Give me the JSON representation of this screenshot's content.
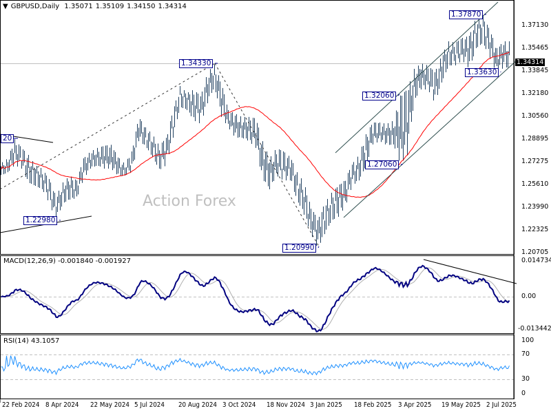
{
  "header": {
    "symbol": "GBPUSD,Daily",
    "open": "1.35071",
    "high": "1.35109",
    "low": "1.34150",
    "close": "1.34314"
  },
  "watermark": "Action Forex",
  "chart_data": [
    {
      "type": "ohlc",
      "title": "GBPUSD,Daily",
      "ylim": [
        1.206,
        1.3892
      ],
      "y_ticks": [
        "1.37130",
        "1.35465",
        "1.33845",
        "1.32180",
        "1.30560",
        "1.28895",
        "1.27275",
        "1.25610",
        "1.23990",
        "1.22325",
        "1.20705"
      ],
      "x_ticks": [
        "22 Feb 2024",
        "8 Apr 2024",
        "22 May 2024",
        "5 Jul 2024",
        "20 Aug 2024",
        "3 Oct 2024",
        "18 Nov 2024",
        "3 Jan 2025",
        "18 Feb 2025",
        "3 Apr 2025",
        "19 May 2025",
        "2 Jul 2025"
      ],
      "current_price": "1.34314",
      "grid": false,
      "moving_average_color": "#ff0000",
      "bar_color": "#1f3f5f",
      "weekly_high_low": [
        [
          1.2717,
          1.2627
        ],
        [
          1.2752,
          1.2652
        ],
        [
          1.2891,
          1.2702
        ],
        [
          1.2827,
          1.2677
        ],
        [
          1.2777,
          1.2578
        ],
        [
          1.2702,
          1.2553
        ],
        [
          1.2677,
          1.2528
        ],
        [
          1.2602,
          1.2428
        ],
        [
          1.2478,
          1.2298
        ],
        [
          1.2578,
          1.2428
        ],
        [
          1.2627,
          1.2453
        ],
        [
          1.2592,
          1.2463
        ],
        [
          1.2752,
          1.2602
        ],
        [
          1.2802,
          1.2677
        ],
        [
          1.2827,
          1.2702
        ],
        [
          1.2842,
          1.2677
        ],
        [
          1.2852,
          1.2677
        ],
        [
          1.2762,
          1.2627
        ],
        [
          1.2712,
          1.2627
        ],
        [
          1.2802,
          1.2652
        ],
        [
          1.3051,
          1.2876
        ],
        [
          1.2976,
          1.2842
        ],
        [
          1.2926,
          1.2762
        ],
        [
          1.2842,
          1.2667
        ],
        [
          1.2901,
          1.2702
        ],
        [
          1.3101,
          1.2901
        ],
        [
          1.3275,
          1.3125
        ],
        [
          1.3225,
          1.3101
        ],
        [
          1.325,
          1.3026
        ],
        [
          1.32,
          1.3001
        ],
        [
          1.3374,
          1.315
        ],
        [
          1.3433,
          1.3275
        ],
        [
          1.33,
          1.3051
        ],
        [
          1.3101,
          1.2976
        ],
        [
          1.3076,
          1.2901
        ],
        [
          1.3051,
          1.2901
        ],
        [
          1.3051,
          1.2876
        ],
        [
          1.3041,
          1.2827
        ],
        [
          1.2876,
          1.2602
        ],
        [
          1.2752,
          1.2528
        ],
        [
          1.2827,
          1.2627
        ],
        [
          1.2802,
          1.2592
        ],
        [
          1.2762,
          1.2592
        ],
        [
          1.2652,
          1.2453
        ],
        [
          1.2578,
          1.2344
        ],
        [
          1.2403,
          1.2204
        ],
        [
          1.2304,
          1.2099
        ],
        [
          1.2428,
          1.2204
        ],
        [
          1.2503,
          1.2304
        ],
        [
          1.2553,
          1.2329
        ],
        [
          1.2602,
          1.2403
        ],
        [
          1.2712,
          1.2553
        ],
        [
          1.2777,
          1.2592
        ],
        [
          1.2926,
          1.2702
        ],
        [
          1.3011,
          1.2852
        ],
        [
          1.3011,
          1.2876
        ],
        [
          1.3001,
          1.2847
        ],
        [
          1.3026,
          1.2852
        ],
        [
          1.3206,
          1.2706
        ],
        [
          1.325,
          1.2777
        ],
        [
          1.3399,
          1.3175
        ],
        [
          1.3439,
          1.325
        ],
        [
          1.3424,
          1.325
        ],
        [
          1.3374,
          1.315
        ],
        [
          1.3499,
          1.33
        ],
        [
          1.3598,
          1.3424
        ],
        [
          1.3588,
          1.3424
        ],
        [
          1.3623,
          1.3459
        ],
        [
          1.3638,
          1.3399
        ],
        [
          1.3773,
          1.3549
        ],
        [
          1.3787,
          1.3588
        ],
        [
          1.3673,
          1.3474
        ],
        [
          1.3549,
          1.3363
        ],
        [
          1.3598,
          1.3409
        ]
      ],
      "annotations": [
        "20",
        "1.22980",
        "1.34330",
        "1.20990",
        "1.27060",
        "1.32060",
        "1.37870",
        "1.33630"
      ]
    },
    {
      "type": "line",
      "title": "MACD(12,26,9)",
      "values_shown": [
        "-0.001840",
        "-0.001927"
      ],
      "y_ticks": [
        "0.014734",
        "0.00",
        "-0.013442"
      ],
      "ylim": [
        -0.013442,
        0.014734
      ],
      "main_color": "#000080",
      "signal_color": "#c0c0c0"
    },
    {
      "type": "line",
      "title": "RSI(14)",
      "value_shown": "43.1057",
      "y_ticks": [
        "100",
        "70",
        "30",
        "0"
      ],
      "ylim": [
        0,
        100
      ],
      "line_color": "#1e90ff"
    }
  ]
}
